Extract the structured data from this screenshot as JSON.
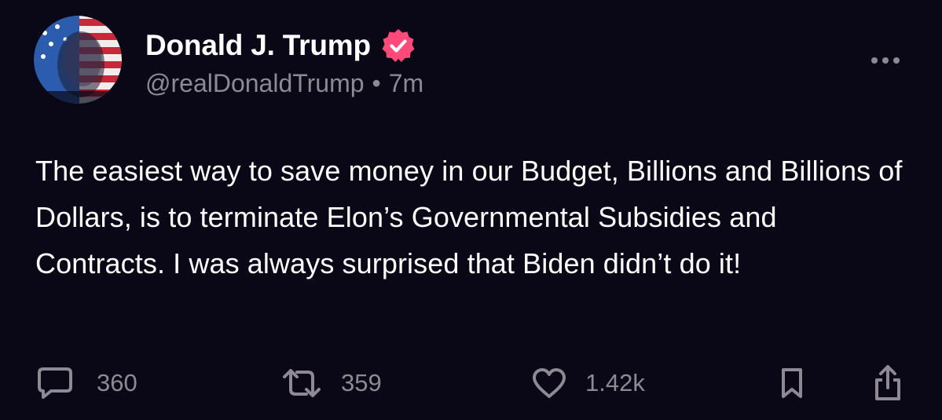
{
  "post": {
    "author": {
      "display_name": "Donald J. Trump",
      "verified": true,
      "handle": "@realDonaldTrump",
      "separator": "•",
      "time": "7m"
    },
    "text": "The easiest way to save money in our Budget, Billions and Billions of Dollars, is to terminate Elon’s Governmental Subsidies and Contracts. I was always surprised that Biden didn’t do it!",
    "actions": {
      "reply_count": "360",
      "repost_count": "359",
      "like_count": "1.42k"
    }
  },
  "colors": {
    "background": "#0a0716",
    "text": "#ffffff",
    "muted": "#8d8a96",
    "verified_badge": "#ff4a7a"
  },
  "icons": {
    "verified": "verified-badge-icon",
    "more": "more-options-icon",
    "reply": "reply-bubble-icon",
    "repost": "repost-arrows-icon",
    "like": "heart-icon",
    "bookmark": "bookmark-icon",
    "share": "share-icon"
  }
}
